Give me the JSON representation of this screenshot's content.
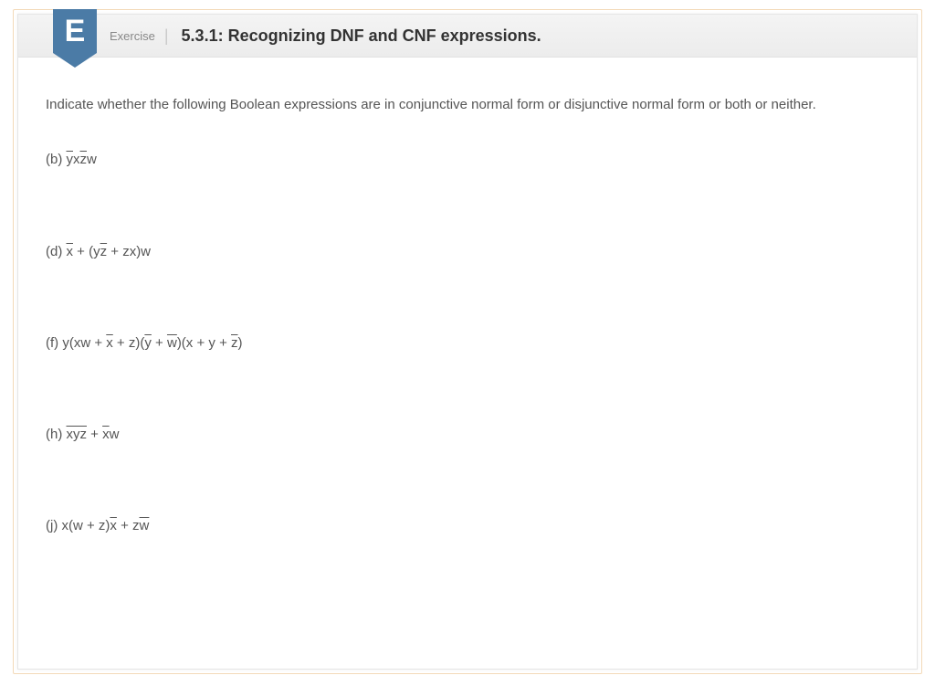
{
  "header": {
    "badge_letter": "E",
    "label": "Exercise",
    "title": "5.3.1: Recognizing DNF and CNF expressions."
  },
  "instructions": "Indicate whether the following Boolean expressions are in conjunctive normal form or disjunctive normal form or both or neither.",
  "questions": {
    "b": {
      "label": "(b) ",
      "parts": [
        {
          "t": "y",
          "ov": true
        },
        {
          "t": "x",
          "ov": false
        },
        {
          "t": "z",
          "ov": true
        },
        {
          "t": "w",
          "ov": false
        }
      ]
    },
    "d": {
      "label": "(d) ",
      "parts": [
        {
          "t": "x",
          "ov": true
        },
        {
          "t": " + (y",
          "ov": false
        },
        {
          "t": "z",
          "ov": true
        },
        {
          "t": " + zx)w",
          "ov": false
        }
      ]
    },
    "f": {
      "label": "(f) ",
      "parts": [
        {
          "t": "y(xw + ",
          "ov": false
        },
        {
          "t": "x",
          "ov": true
        },
        {
          "t": " + z)(",
          "ov": false
        },
        {
          "t": "y",
          "ov": true
        },
        {
          "t": " + ",
          "ov": false
        },
        {
          "t": "w",
          "ov": true
        },
        {
          "t": ")(x + y + ",
          "ov": false
        },
        {
          "t": "z",
          "ov": true
        },
        {
          "t": ")",
          "ov": false
        }
      ]
    },
    "h": {
      "label": "(h) ",
      "parts": [
        {
          "t": "xyz",
          "ov": true
        },
        {
          "t": " + ",
          "ov": false
        },
        {
          "t": "x",
          "ov": true
        },
        {
          "t": "w",
          "ov": false
        }
      ]
    },
    "j": {
      "label": "(j) ",
      "parts": [
        {
          "t": "x(w + z)",
          "ov": false
        },
        {
          "t": "x",
          "ov": true
        },
        {
          "t": " + z",
          "ov": false
        },
        {
          "t": "w",
          "ov": true
        }
      ]
    }
  }
}
